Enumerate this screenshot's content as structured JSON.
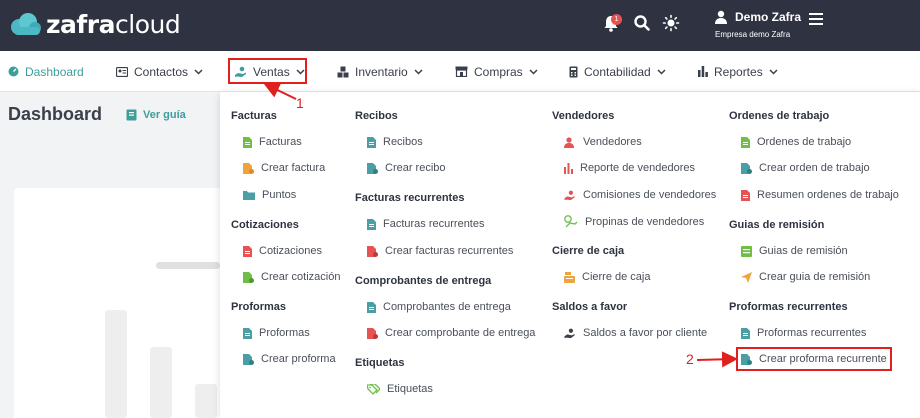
{
  "brand": {
    "name_bold": "zafra",
    "name_light": "cloud"
  },
  "header": {
    "notifications_count": "1",
    "user_name": "Demo Zafra",
    "company": "Empresa demo Zafra"
  },
  "nav": {
    "dashboard": "Dashboard",
    "contactos": "Contactos",
    "ventas": "Ventas",
    "inventario": "Inventario",
    "compras": "Compras",
    "contabilidad": "Contabilidad",
    "reportes": "Reportes"
  },
  "page": {
    "title": "Dashboard",
    "guide": "Ver guía"
  },
  "menu": {
    "col1": {
      "facturas_title": "Facturas",
      "facturas": "Facturas",
      "crear_factura": "Crear factura",
      "puntos": "Puntos",
      "cotizaciones_title": "Cotizaciones",
      "cotizaciones": "Cotizaciones",
      "crear_cotizacion": "Crear cotización",
      "proformas_title": "Proformas",
      "proformas": "Proformas",
      "crear_proforma": "Crear proforma"
    },
    "col2": {
      "recibos_title": "Recibos",
      "recibos": "Recibos",
      "crear_recibo": "Crear recibo",
      "facturas_rec_title": "Facturas recurrentes",
      "facturas_rec": "Facturas recurrentes",
      "crear_facturas_rec": "Crear facturas recurrentes",
      "comprobantes_title": "Comprobantes de entrega",
      "comprobantes": "Comprobantes de entrega",
      "crear_comprobante": "Crear comprobante de entrega",
      "etiquetas_title": "Etiquetas",
      "etiquetas": "Etiquetas"
    },
    "col3": {
      "vendedores_title": "Vendedores",
      "vendedores": "Vendedores",
      "reporte_vendedores": "Reporte de vendedores",
      "comisiones": "Comisiones de vendedores",
      "propinas": "Propinas de vendedores",
      "cierre_title": "Cierre de caja",
      "cierre": "Cierre de caja",
      "saldos_title": "Saldos a favor",
      "saldos": "Saldos a favor por cliente"
    },
    "col4": {
      "ordenes_title": "Ordenes de trabajo",
      "ordenes": "Ordenes de trabajo",
      "crear_orden": "Crear orden de trabajo",
      "resumen_ordenes": "Resumen ordenes de trabajo",
      "guias_title": "Guias de remisión",
      "guias": "Guias de remisión",
      "crear_guia": "Crear guia de remisión",
      "proformas_rec_title": "Proformas recurrentes",
      "proformas_rec": "Proformas recurrentes",
      "crear_proforma_rec": "Crear proforma recurrente"
    }
  },
  "annotations": {
    "step1": "1",
    "step2": "2"
  },
  "colors": {
    "topbar": "#2f3341",
    "accent": "#3e9e9a",
    "highlight": "#e0201f",
    "icon_green": "#6fbf47",
    "icon_orange": "#f0a33a",
    "icon_red": "#e55353",
    "icon_teal": "#4a9fa5"
  },
  "icons": {
    "doc_green": "document-icon",
    "doc_orange": "add-document-icon",
    "doc_red": "add-document-icon",
    "folder_teal": "folder-icon",
    "person": "user-icon",
    "chart": "bar-chart-icon",
    "hand": "hand-coin-icon",
    "tip": "tip-icon",
    "box": "cash-register-icon",
    "plane": "paper-plane-icon",
    "tag": "tag-icon"
  }
}
